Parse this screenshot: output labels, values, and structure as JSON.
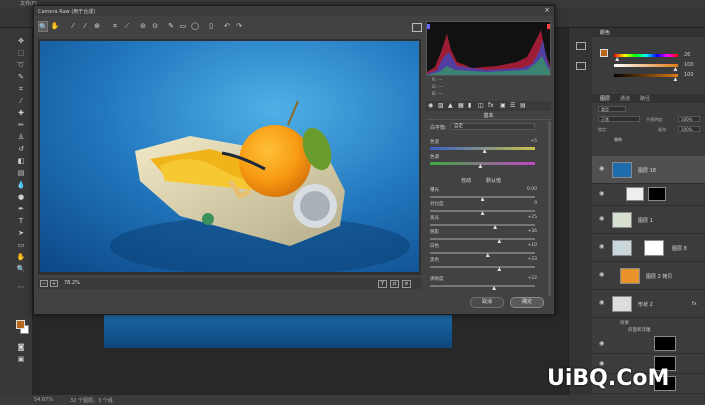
{
  "menubar": {
    "file": "文件(F)"
  },
  "dialog": {
    "title": "Camera Raw (用于合成)",
    "zoom": "78.2%",
    "cancel_label": "取消",
    "ok_label": "确定",
    "view_y": "Y",
    "toolbar_icons": [
      "zoom-icon",
      "hand-icon",
      "white-balance-icon",
      "color-sampler-icon",
      "target-adjust-icon",
      "crop-icon",
      "straighten-icon",
      "spot-removal-icon",
      "redeye-icon",
      "adjust-brush-icon",
      "graduated-filter-icon",
      "radial-filter-icon",
      "preferences-icon",
      "rotate-left-icon",
      "rotate-right-icon"
    ]
  },
  "histogram_info": {
    "r": "R: ---",
    "g": "G: ---",
    "b": "B: ---"
  },
  "basic_panel": {
    "title": "基本",
    "wb_label": "白平衡:",
    "wb_value": "自定",
    "auto": "自动",
    "default": "默认值",
    "sliders": [
      {
        "label": "色温",
        "value": "+5",
        "pos": 0.52
      },
      {
        "label": "色调",
        "value": "",
        "pos": 0.48
      },
      {
        "label": "曝光",
        "value": "0.00",
        "pos": 0.5
      },
      {
        "label": "对比度",
        "value": "0",
        "pos": 0.5
      },
      {
        "label": "高光",
        "value": "+25",
        "pos": 0.62
      },
      {
        "label": "阴影",
        "value": "+36",
        "pos": 0.66
      },
      {
        "label": "白色",
        "value": "+10",
        "pos": 0.55
      },
      {
        "label": "黑色",
        "value": "+33",
        "pos": 0.66
      },
      {
        "label": "清晰度",
        "value": "+22",
        "pos": 0.61
      }
    ]
  },
  "color_panel": {
    "tab": "颜色",
    "values": [
      "26",
      "100",
      "100"
    ],
    "levels": [
      0.05,
      0.96,
      0.96
    ]
  },
  "layers_panel": {
    "tabs": [
      "图层",
      "通道",
      "路径"
    ],
    "kind": "类型",
    "blend": "正常",
    "opacity_label": "不透明度:",
    "opacity": "100%",
    "lock_label": "锁定:",
    "fill_label": "填充:",
    "fill": "100%",
    "group_label": "装饰",
    "layers": [
      {
        "name": "图层 18"
      },
      {
        "name": ""
      },
      {
        "name": "图层 1"
      },
      {
        "name": "图层 8"
      },
      {
        "name": "图层 2 拷贝"
      },
      {
        "name": "形状 2"
      }
    ],
    "effects": "效果",
    "effect_item": "斜面和浮雕"
  },
  "statusbar": {
    "zoom": "54.67%",
    "layers": "32 个图层，3 个组"
  },
  "watermark": "UiBQ.CoM"
}
